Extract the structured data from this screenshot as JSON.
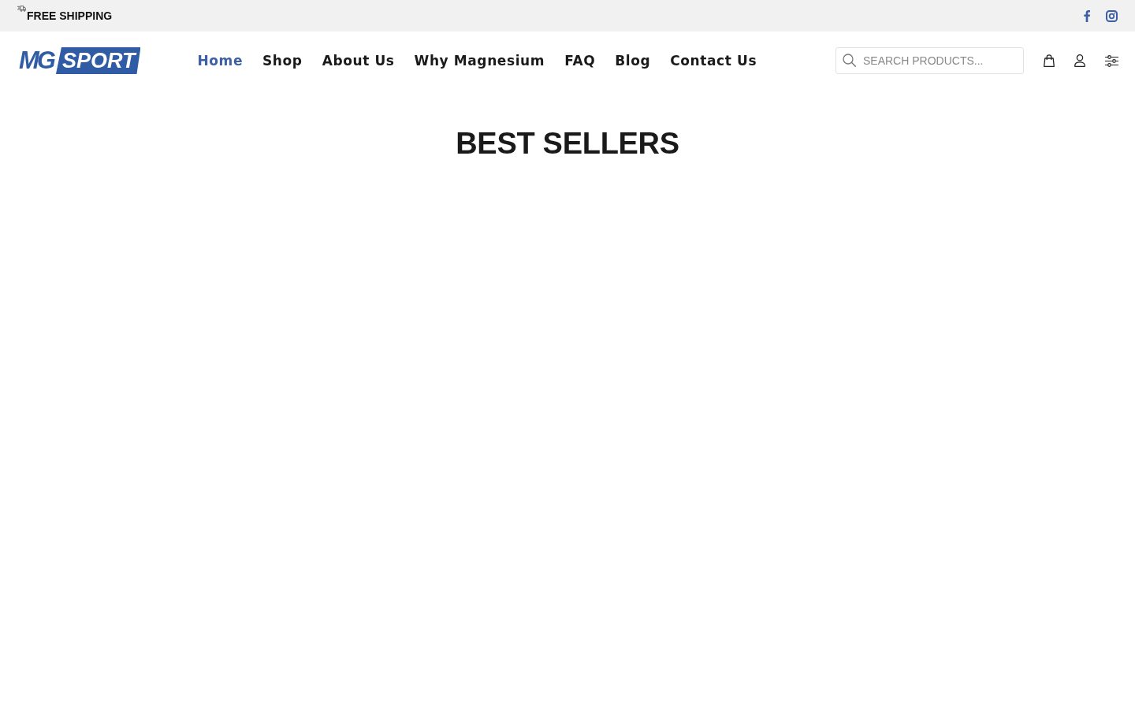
{
  "top_bar": {
    "shipping_text": "FREE SHIPPING"
  },
  "header": {
    "logo": {
      "mark": "MG",
      "wordmark": "SPORT"
    },
    "nav": [
      {
        "label": "Home",
        "selected": true
      },
      {
        "label": "Shop",
        "selected": false
      },
      {
        "label": "About Us",
        "selected": false
      },
      {
        "label": "Why Magnesium",
        "selected": false
      },
      {
        "label": "FAQ",
        "selected": false
      },
      {
        "label": "Blog",
        "selected": false
      },
      {
        "label": "Contact Us",
        "selected": false
      }
    ],
    "search": {
      "placeholder": "SEARCH PRODUCTS..."
    }
  },
  "main": {
    "title": "BEST SELLERS"
  }
}
